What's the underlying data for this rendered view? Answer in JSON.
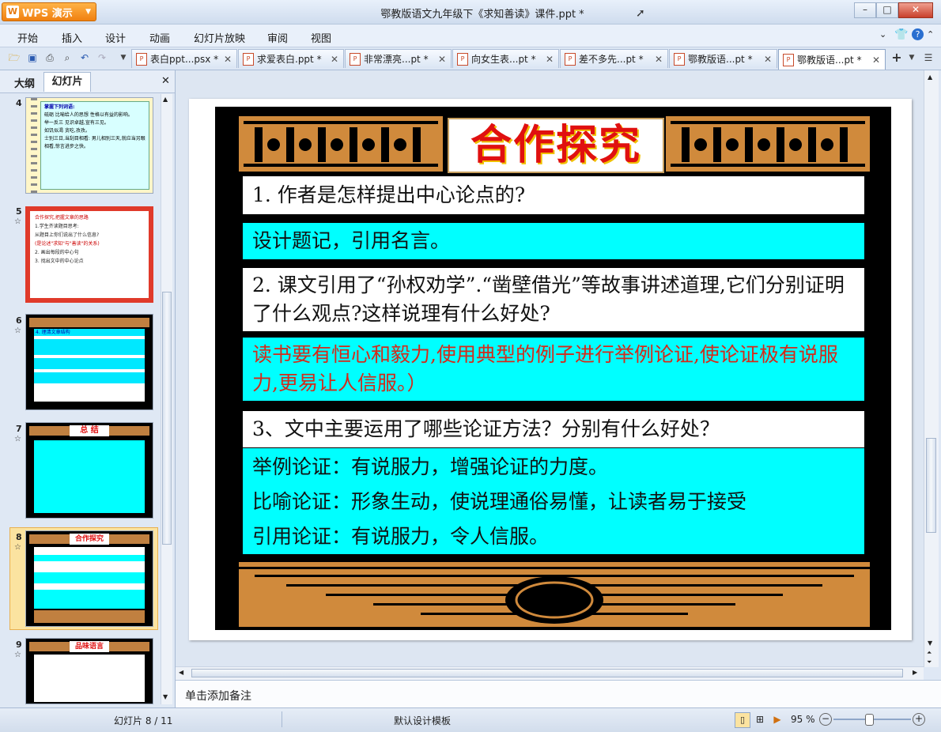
{
  "titlebar": {
    "app_button": "WPS 演示",
    "doc_title": "鄂教版语文九年级下《求知善读》课件.ppt *",
    "win_minimize": "–",
    "win_maximize": "□",
    "win_close": "✕"
  },
  "menu": [
    "开始",
    "插入",
    "设计",
    "动画",
    "幻灯片放映",
    "审阅",
    "视图"
  ],
  "tabs": [
    {
      "label": "表白ppt...psx *"
    },
    {
      "label": "求爱表白.ppt *"
    },
    {
      "label": "非常漂亮...pt *"
    },
    {
      "label": "向女生表...pt *"
    },
    {
      "label": "差不多先...pt *"
    },
    {
      "label": "鄂教版语...pt *"
    },
    {
      "label": "鄂教版语...pt *"
    }
  ],
  "active_tab_index": 6,
  "left_panel": {
    "tab_outline": "大纲",
    "tab_slides": "幻灯片",
    "close": "✕",
    "slides": [
      {
        "number": "4",
        "star": ""
      },
      {
        "number": "5",
        "star": "☆"
      },
      {
        "number": "6",
        "star": "☆"
      },
      {
        "number": "7",
        "star": "☆"
      },
      {
        "number": "8",
        "star": "☆"
      },
      {
        "number": "9",
        "star": "☆"
      }
    ],
    "thumb_texts": {
      "s4_title": "掌握下列词语:",
      "s4_l1": "砥砺 比喻给人的思想 性格以有益的影响。",
      "s4_l2": "举一反三 见识卓越,宣有三见。",
      "s4_l3": "如饥似渴 贪吃,孜孜。",
      "s4_l4": "士别三日,当刮目相看: 男儿相别三天,就应当另眼相看,惊言进步之快。",
      "s5_title": "合作探究,把握文章的思路",
      "s5_l1": "1.学生齐读题目思考:",
      "s5_l2": "从题目上你们说出了什么信息?",
      "s5_l3": "(是论述\"求知\"与\"善读\"的关系)",
      "s5_l4": "2. 画出每段的中心句",
      "s5_l5": "3. 找出文中的中心论点",
      "s6_title": "4. 理清文章结构",
      "s7_title": "总 结",
      "s8_title": "合作探究",
      "s9_title": "品味语言"
    }
  },
  "slide": {
    "title": "合作探究",
    "q1": "1. 作者是怎样提出中心论点的?",
    "a1": "设计题记，引用名言。",
    "q2": "2. 课文引用了“孙权劝学”.“凿壁借光”等故事讲述道理,它们分别证明了什么观点?这样说理有什么好处?",
    "a2": "读书要有恒心和毅力,使用典型的例子进行举例论证,使论证极有说服力,更易让人信服。）",
    "q3": "3、文中主要运用了哪些论证方法？分别有什么好处？",
    "a3_l1": "举例论证：有说服力，增强论证的力度。",
    "a3_l2": "比喻论证：形象生动，使说理通俗易懂，让读者易于接受",
    "a3_l3": "引用论证：有说服力，令人信服。",
    "a2_color": "#d42a1a"
  },
  "notes": {
    "placeholder": "单击添加备注"
  },
  "status": {
    "slide_count": "幻灯片 8 / 11",
    "template": "默认设计模板",
    "zoom": "95 %"
  },
  "colors": {
    "accent_orange": "#f08010",
    "cyan": "#00ffff",
    "title_red": "#e01010"
  }
}
